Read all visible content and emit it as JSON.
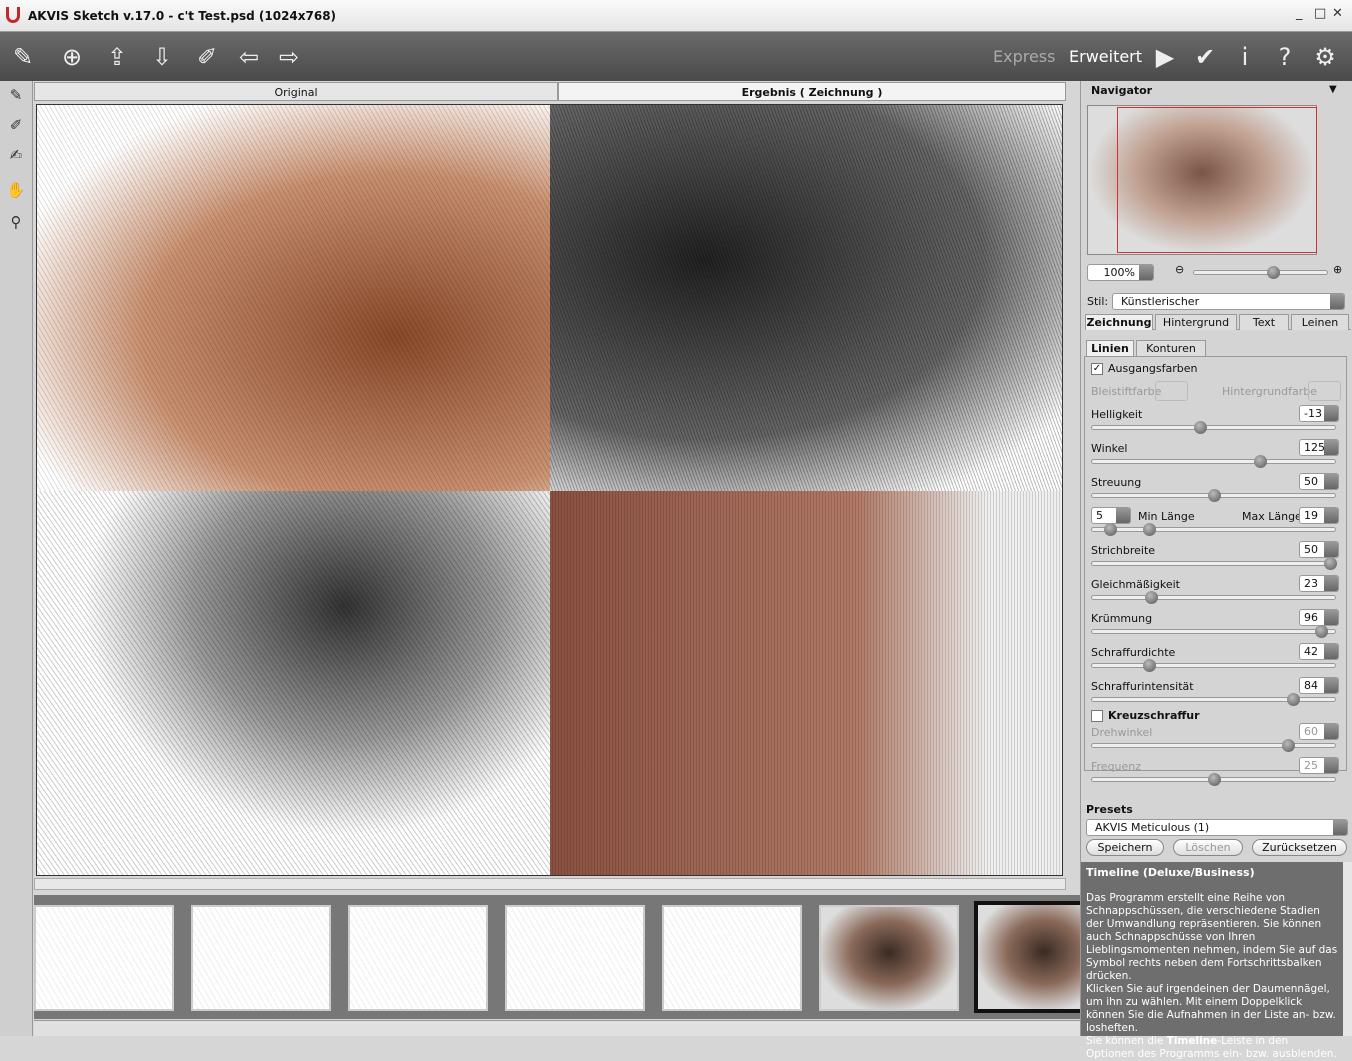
{
  "window": {
    "title": "AKVIS Sketch v.17.0 - c't Test.psd (1024x768)"
  },
  "toolbar": {
    "modes": {
      "express": "Express",
      "advanced": "Erweitert"
    }
  },
  "view_tabs": {
    "original": "Original",
    "result": "Ergebnis ( Zeichnung )"
  },
  "navigator": {
    "title": "Navigator",
    "zoom": "100%",
    "zoom_slider_fraction": 0.6
  },
  "style": {
    "label": "Stil:",
    "value": "Künstlerischer"
  },
  "main_tabs": [
    "Zeichnung",
    "Hintergrund",
    "Text",
    "Leinen"
  ],
  "sub_tabs": [
    "Linien",
    "Konturen"
  ],
  "source_colors": {
    "label": "Ausgangsfarben",
    "checked": true
  },
  "pencil_color": "Bleistiftfarbe",
  "bg_color": "Hintergrundfarbe",
  "params": [
    {
      "label": "Helligkeit",
      "value": "-13",
      "fraction": 0.44
    },
    {
      "label": "Winkel",
      "value": "125",
      "fraction": 0.7
    },
    {
      "label": "Streuung",
      "value": "50",
      "fraction": 0.5
    },
    {
      "label": "Strichbreite",
      "value": "50",
      "fraction": 1.0
    },
    {
      "label": "Gleichmäßigkeit",
      "value": "23",
      "fraction": 0.23
    },
    {
      "label": "Krümmung",
      "value": "96",
      "fraction": 0.96
    },
    {
      "label": "Schraffurdichte",
      "value": "42",
      "fraction": 0.22
    },
    {
      "label": "Schraffurintensität",
      "value": "84",
      "fraction": 0.84
    }
  ],
  "length": {
    "min_label": "Min Länge",
    "min": "5",
    "max_label": "Max Länge",
    "max": "19",
    "min_fraction": 0.05,
    "max_fraction": 0.22
  },
  "crosshatch": {
    "label": "Kreuzschraffur",
    "checked": false,
    "params": [
      {
        "label": "Drehwinkel",
        "value": "60",
        "fraction": 0.82
      },
      {
        "label": "Frequenz",
        "value": "25",
        "fraction": 0.5
      }
    ]
  },
  "presets": {
    "title": "Presets",
    "value": "AKVIS Meticulous (1)",
    "save": "Speichern",
    "delete": "Löschen",
    "reset": "Zurücksetzen"
  },
  "help": {
    "title": "Timeline (Deluxe/Business)",
    "p1": "Das Programm erstellt eine Reihe von Schnappschüssen, die verschiedene Stadien der Umwandlung repräsentieren. Sie können auch Schnappschüsse von Ihren Lieblingsmomenten nehmen, indem Sie auf das Symbol rechts neben dem Fortschrittsbalken drücken.",
    "p2": "Klicken Sie auf irgendeinen der Daumennägel, um ihn zu wählen. Mit einem Doppelklick können Sie die Aufnahmen in der Liste an- bzw. losheften.",
    "p3a": "Sie können die ",
    "p3b": "Timeline",
    "p3c": "-Leiste in den Optionen des Programms ein- bzw. ausblenden."
  },
  "colors": {
    "toolbar": "#555555",
    "panel": "#d4d4d4",
    "help_bg": "#6e6e6e"
  }
}
